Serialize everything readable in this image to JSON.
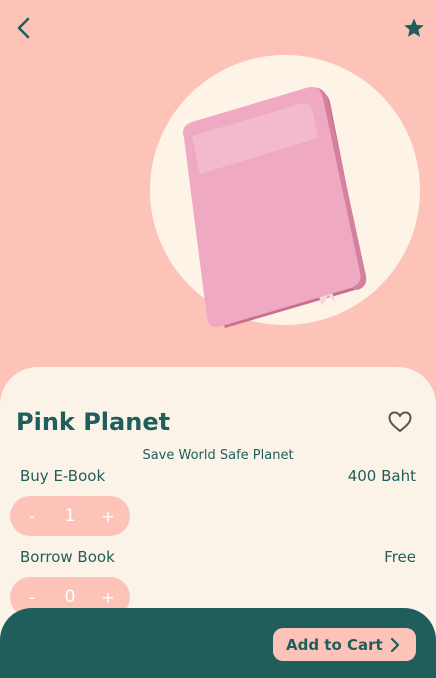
{
  "colors": {
    "background": "#FDC3B8",
    "accent_dark": "#1F5E5B",
    "card": "#FCF3E8",
    "circle": "#FDF4E7",
    "book": "#EFA9C3"
  },
  "header": {
    "back_icon": "chevron-left-icon",
    "favorite_icon": "star-icon"
  },
  "product": {
    "title": "Pink Planet",
    "subtitle": "Save World Safe Planet",
    "like_icon": "heart-outline-icon",
    "image_icon": "book-icon"
  },
  "options": [
    {
      "label": "Buy E-Book",
      "price": "400 Baht",
      "minus": "-",
      "quantity": "1",
      "plus": "+"
    },
    {
      "label": "Borrow Book",
      "price": "Free",
      "minus": "-",
      "quantity": "0",
      "plus": "+"
    }
  ],
  "footer": {
    "cart_label": "Add to Cart",
    "cart_icon": "chevron-right-icon"
  }
}
